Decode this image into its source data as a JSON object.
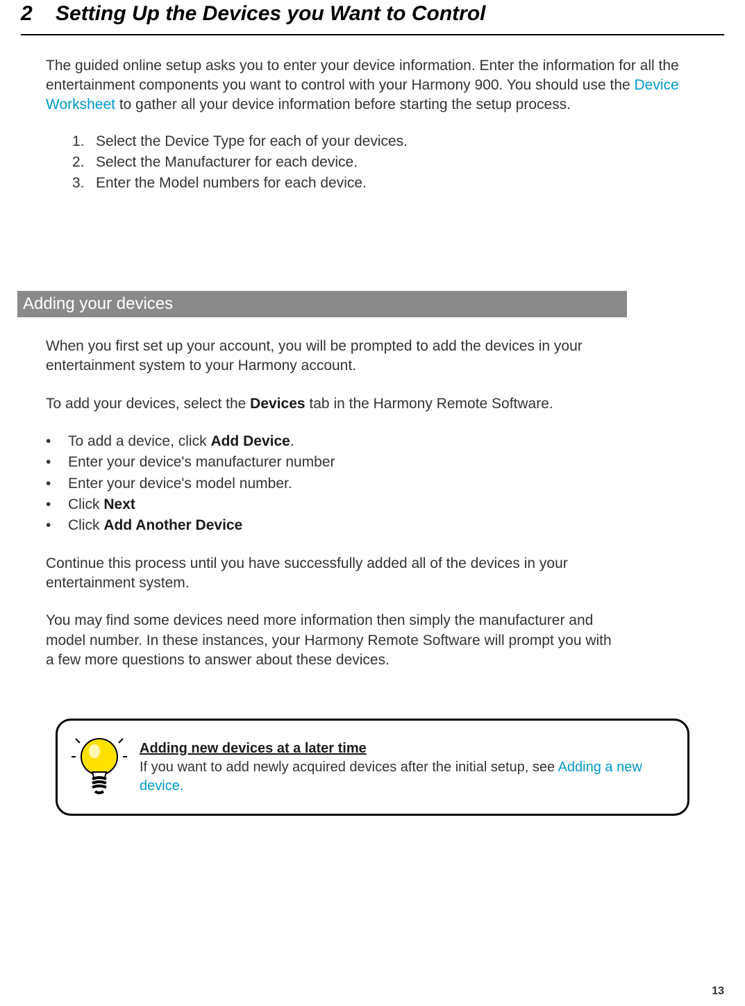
{
  "section": {
    "number": "2",
    "title": "Setting Up the Devices you Want to Control"
  },
  "intro": {
    "part1": "The guided online setup asks you to enter your device information.  Enter the information for all the entertainment components you want to control with your Harmony 900. You should use the ",
    "link": "Device Worksheet",
    "part2": " to gather all your device information before starting the setup process."
  },
  "steps": [
    {
      "n": "1.",
      "t": "Select the Device Type for each of your devices."
    },
    {
      "n": "2.",
      "t": "Select the Manufacturer for each device."
    },
    {
      "n": "3.",
      "t": "Enter the Model numbers for each device."
    }
  ],
  "subheading": "Adding your devices",
  "sub": {
    "p1": "When you first set up your account, you will be prompted to add the devices in your entertainment system to your Harmony account.",
    "p2a": "To add your devices, select the ",
    "p2_bold": "Devices",
    "p2b": " tab in the Harmony Remote Software.",
    "bullets": [
      {
        "pre": "To add a device, click ",
        "bold": "Add Device",
        "post": "."
      },
      {
        "pre": "Enter your device's manufacturer number",
        "bold": "",
        "post": ""
      },
      {
        "pre": "Enter your device's model number.",
        "bold": "",
        "post": ""
      },
      {
        "pre": "Click ",
        "bold": "Next",
        "post": ""
      },
      {
        "pre": "Click ",
        "bold": "Add Another Device",
        "post": ""
      }
    ],
    "p3": "Continue this process until you have successfully added all of the devices in your entertainment system.",
    "p4": "You may find some devices need more information then simply the manufacturer and model number. In these instances, your Harmony Remote Software will prompt you with a few more questions to answer about these devices."
  },
  "tip": {
    "title": "Adding new devices at a later time",
    "body_pre": "If you want to add newly acquired devices after the initial setup, see ",
    "body_link": "Adding a new device."
  },
  "page_number": "13"
}
